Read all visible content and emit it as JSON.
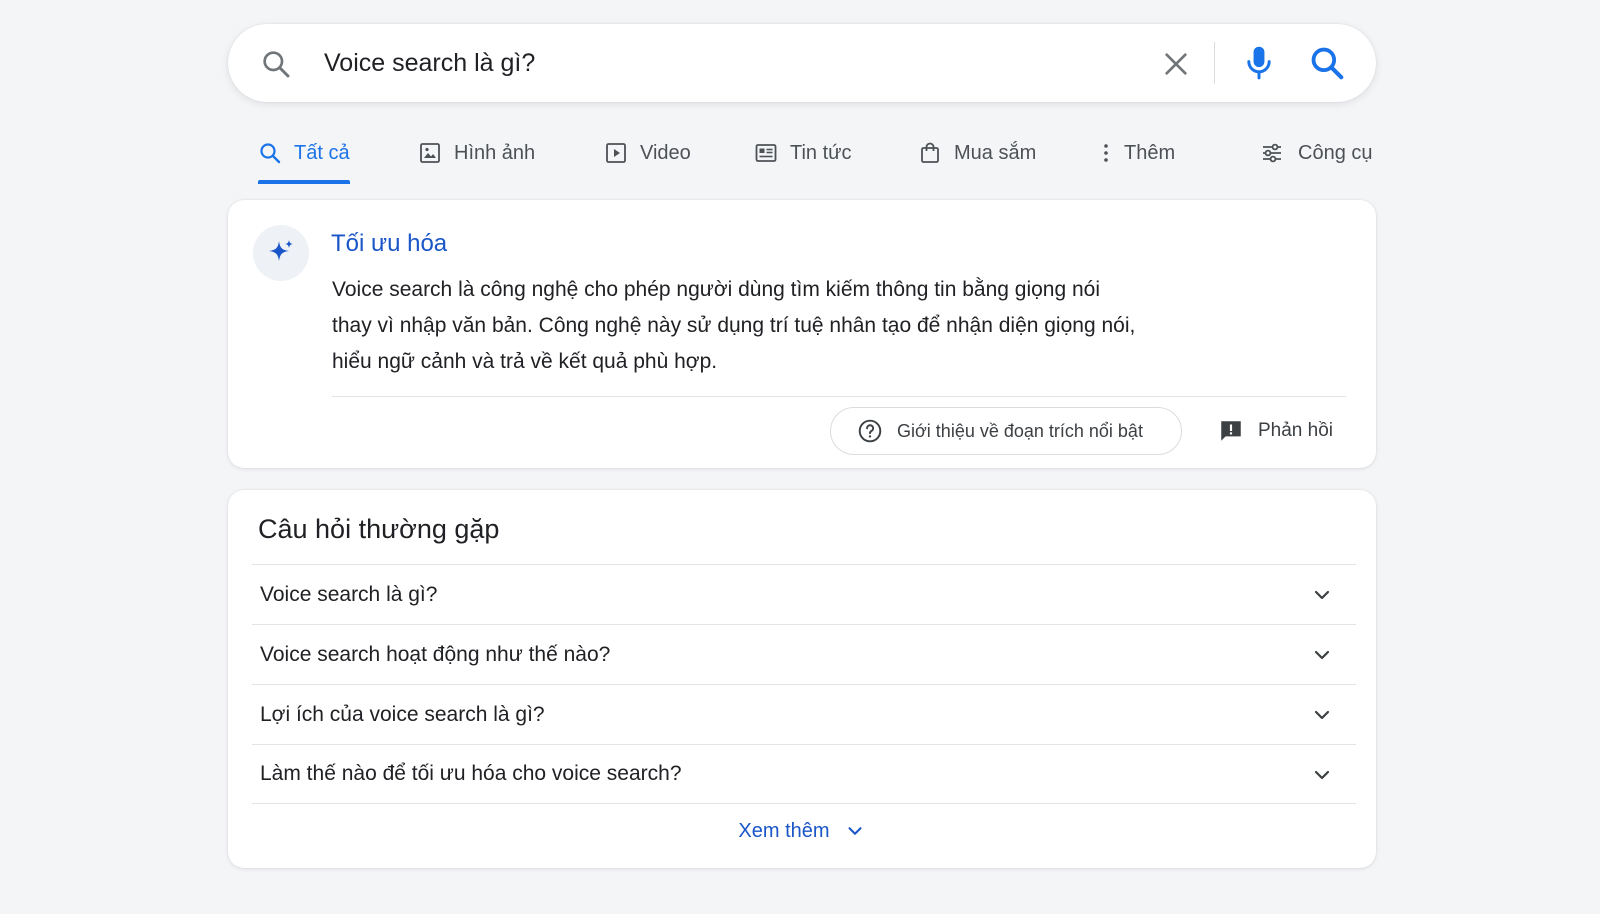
{
  "search": {
    "query": "Voice search là gì?"
  },
  "tabs": [
    {
      "label": "Tất cả",
      "icon": "search-icon",
      "active": true
    },
    {
      "label": "Hình ảnh",
      "icon": "image-icon"
    },
    {
      "label": "Video",
      "icon": "video-icon"
    },
    {
      "label": "Tin tức",
      "icon": "news-icon"
    },
    {
      "label": "Mua sắm",
      "icon": "shopping-bag-icon"
    },
    {
      "label": "Thêm",
      "icon": "more-vert-icon"
    },
    {
      "label": "Công cụ",
      "icon": "tune-icon"
    }
  ],
  "snippet": {
    "title": "Tối ưu hóa",
    "text_lines": [
      "Voice search là công nghệ cho phép người dùng tìm kiếm thông tin bằng giọng nói",
      "thay vì nhập văn bản. Công nghệ này sử dụng trí tuệ nhân tạo để nhận diện giọng nói,",
      "hiểu ngữ cảnh và trả về kết quả phù hợp."
    ],
    "about_label": "Giới thiệu về đoạn trích nổi bật",
    "feedback_label": "Phản hồi"
  },
  "faq": {
    "title": "Câu hỏi thường gặp",
    "items": [
      "Voice search là gì?",
      "Voice search hoạt động như thế nào?",
      "Lợi ích của voice search là gì?",
      "Làm thế nào để tối ưu hóa cho voice search?"
    ],
    "more_label": "Xem thêm"
  },
  "colors": {
    "accent": "#1a73e8",
    "link": "#1a56c8",
    "text": "#202124",
    "muted": "#4d5156"
  }
}
